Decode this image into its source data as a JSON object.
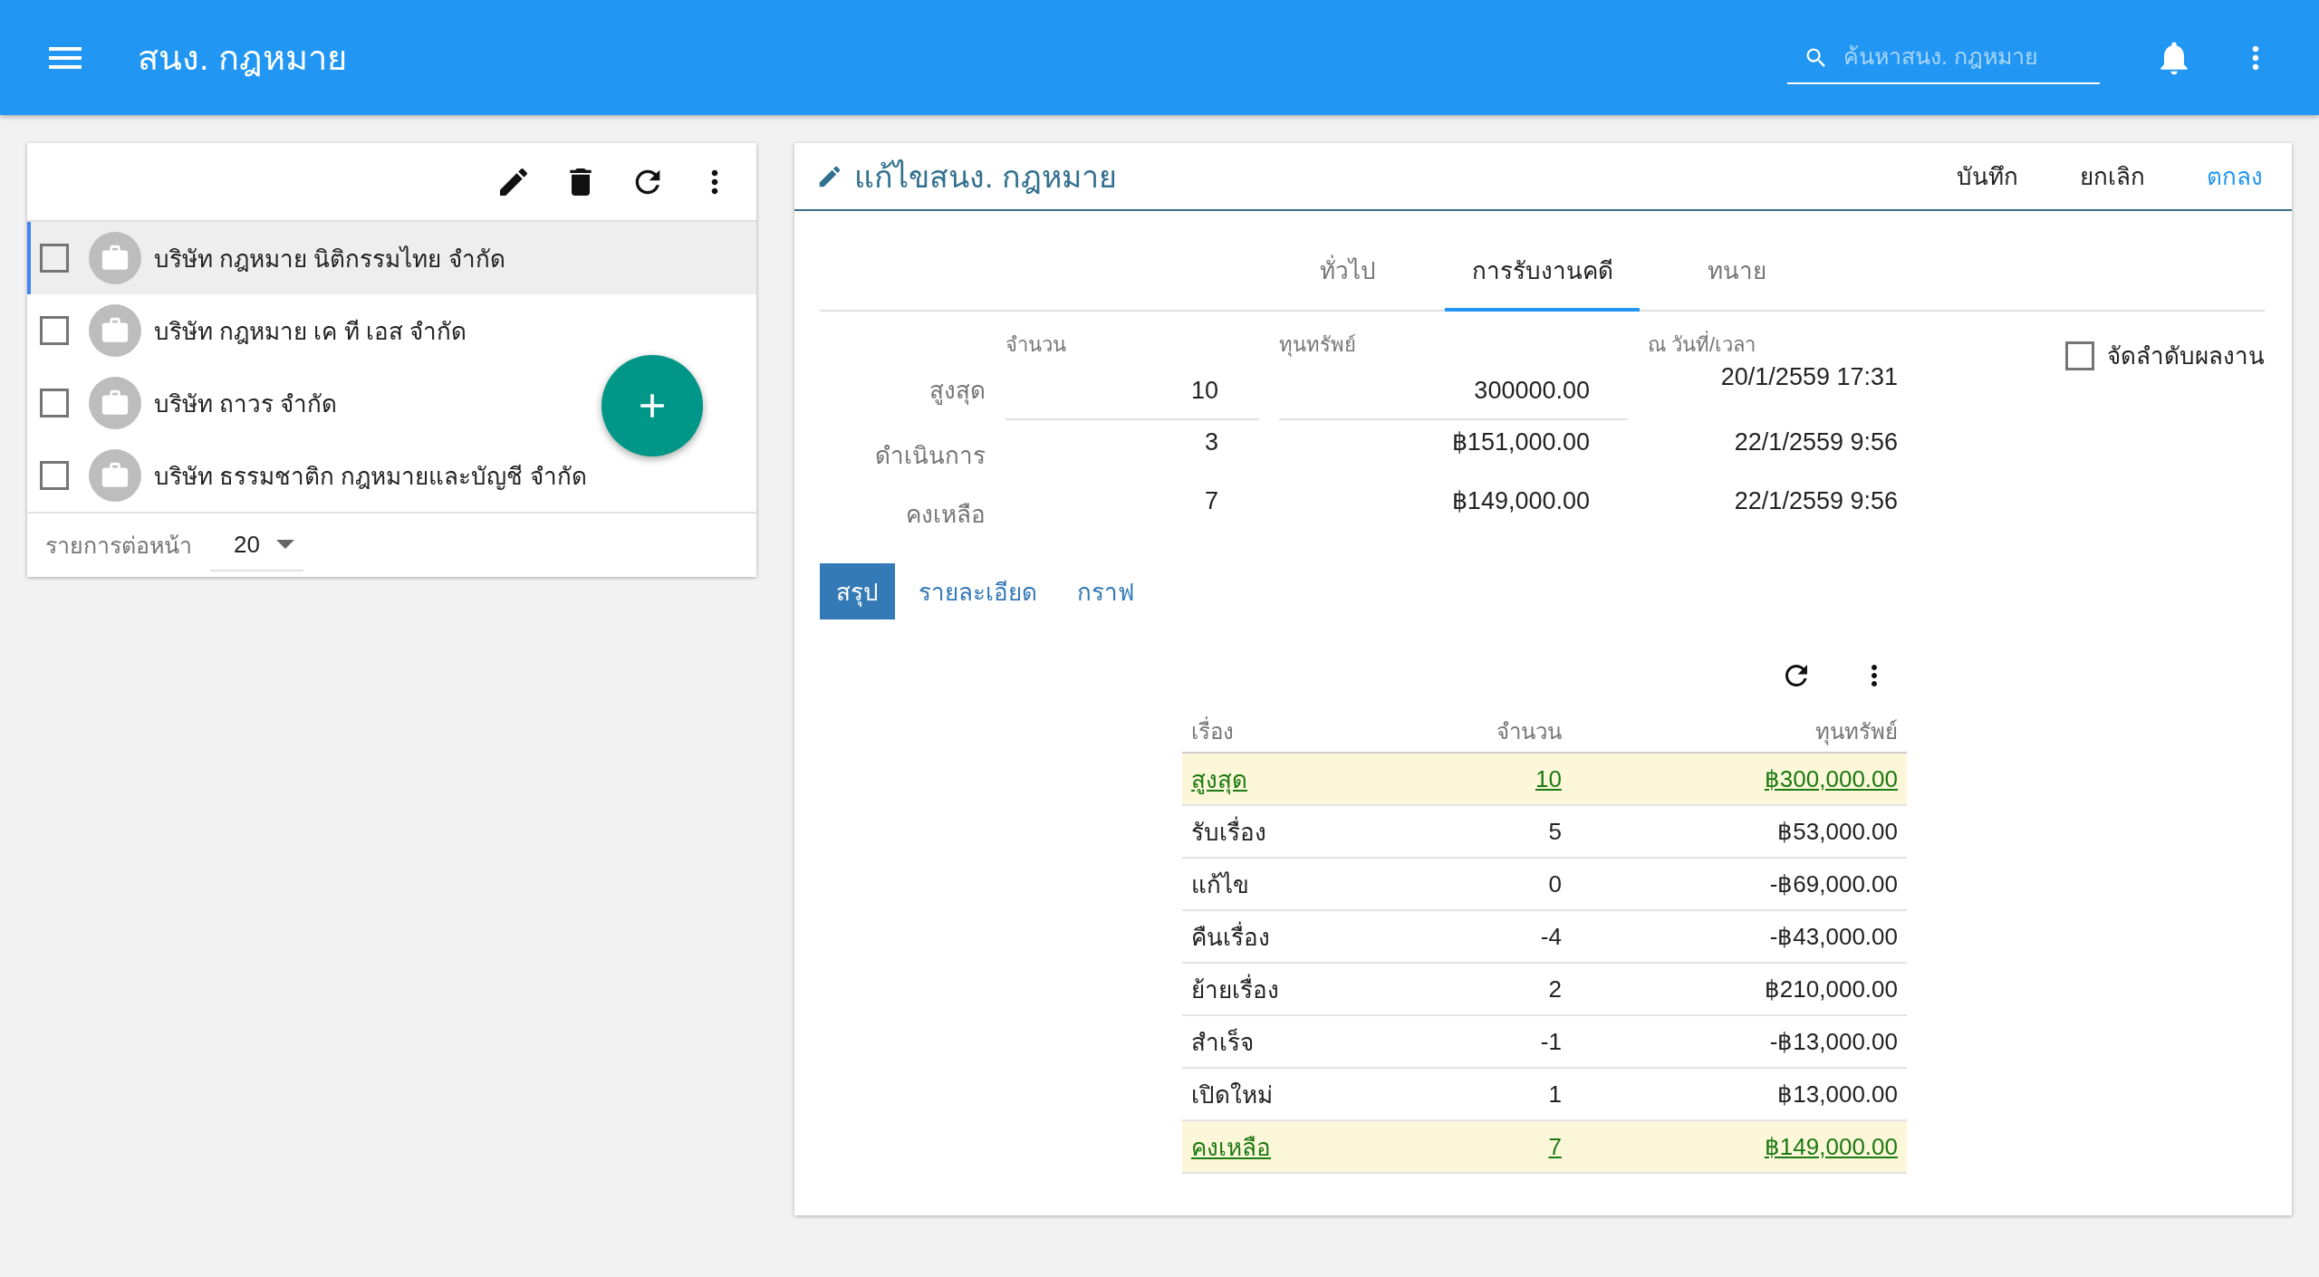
{
  "app_bar": {
    "title": "สนง. กฎหมาย",
    "search": {
      "placeholder": "ค้นหาสนง. กฎหมาย"
    }
  },
  "list_panel": {
    "items": [
      {
        "name": "บริษัท กฎหมาย นิติกรรมไทย จำกัด",
        "checked": false,
        "selected": true
      },
      {
        "name": "บริษัท กฎหมาย เค ที เอส จำกัด",
        "checked": false,
        "selected": false
      },
      {
        "name": "บริษัท ถาวร จำกัด",
        "checked": false,
        "selected": false
      },
      {
        "name": "บริษัท ธรรมชาติก กฎหมายและบัญชี จำกัด",
        "checked": false,
        "selected": false
      }
    ],
    "page_size_label": "รายการต่อหน้า",
    "page_size": "20"
  },
  "editor": {
    "title": "แก้ไขสนง. กฎหมาย",
    "actions": [
      {
        "label": "บันทึก",
        "primary": false
      },
      {
        "label": "ยกเลิก",
        "primary": false
      },
      {
        "label": "ตกลง",
        "primary": true
      }
    ],
    "tabs": [
      {
        "label": "ทั่วไป",
        "selected": false
      },
      {
        "label": "การรับงานคดี",
        "selected": true
      },
      {
        "label": "ทนาย",
        "selected": false
      }
    ],
    "stats": {
      "columns": [
        "จำนวน",
        "ทุนทรัพย์",
        "ณ วันที่/เวลา"
      ],
      "rows": [
        {
          "kind": "input",
          "label": "สูงสุด",
          "count": "10",
          "amount": "300000.00",
          "datetime": "20/1/2559 17:31"
        },
        {
          "kind": "text",
          "label": "ดำเนินการ",
          "count": "3",
          "amount": "฿151,000.00",
          "datetime": "22/1/2559 9:56"
        },
        {
          "kind": "text",
          "label": "คงเหลือ",
          "count": "7",
          "amount": "฿149,000.00",
          "datetime": "22/1/2559 9:56"
        }
      ]
    },
    "sort_option": {
      "label": "จัดลำดับผลงาน",
      "checked": false
    },
    "view_tabs": [
      {
        "label": "สรุป",
        "selected": true
      },
      {
        "label": "รายละเอียด",
        "selected": false
      },
      {
        "label": "กราฟ",
        "selected": false
      }
    ],
    "summary_table": {
      "columns": [
        "เรื่อง",
        "จำนวน",
        "ทุนทรัพย์"
      ],
      "rows": [
        {
          "cells": [
            "สูงสุด",
            "10",
            "฿300,000.00"
          ],
          "highlight": true
        },
        {
          "cells": [
            "รับเรื่อง",
            "5",
            "฿53,000.00"
          ],
          "highlight": false
        },
        {
          "cells": [
            "แก้ไข",
            "0",
            "-฿69,000.00"
          ],
          "highlight": false
        },
        {
          "cells": [
            "คืนเรื่อง",
            "-4",
            "-฿43,000.00"
          ],
          "highlight": false
        },
        {
          "cells": [
            "ย้ายเรื่อง",
            "2",
            "฿210,000.00"
          ],
          "highlight": false
        },
        {
          "cells": [
            "สำเร็จ",
            "-1",
            "-฿13,000.00"
          ],
          "highlight": false
        },
        {
          "cells": [
            "เปิดใหม่",
            "1",
            "฿13,000.00"
          ],
          "highlight": false
        },
        {
          "cells": [
            "คงเหลือ",
            "7",
            "฿149,000.00"
          ],
          "highlight": true
        }
      ]
    }
  }
}
